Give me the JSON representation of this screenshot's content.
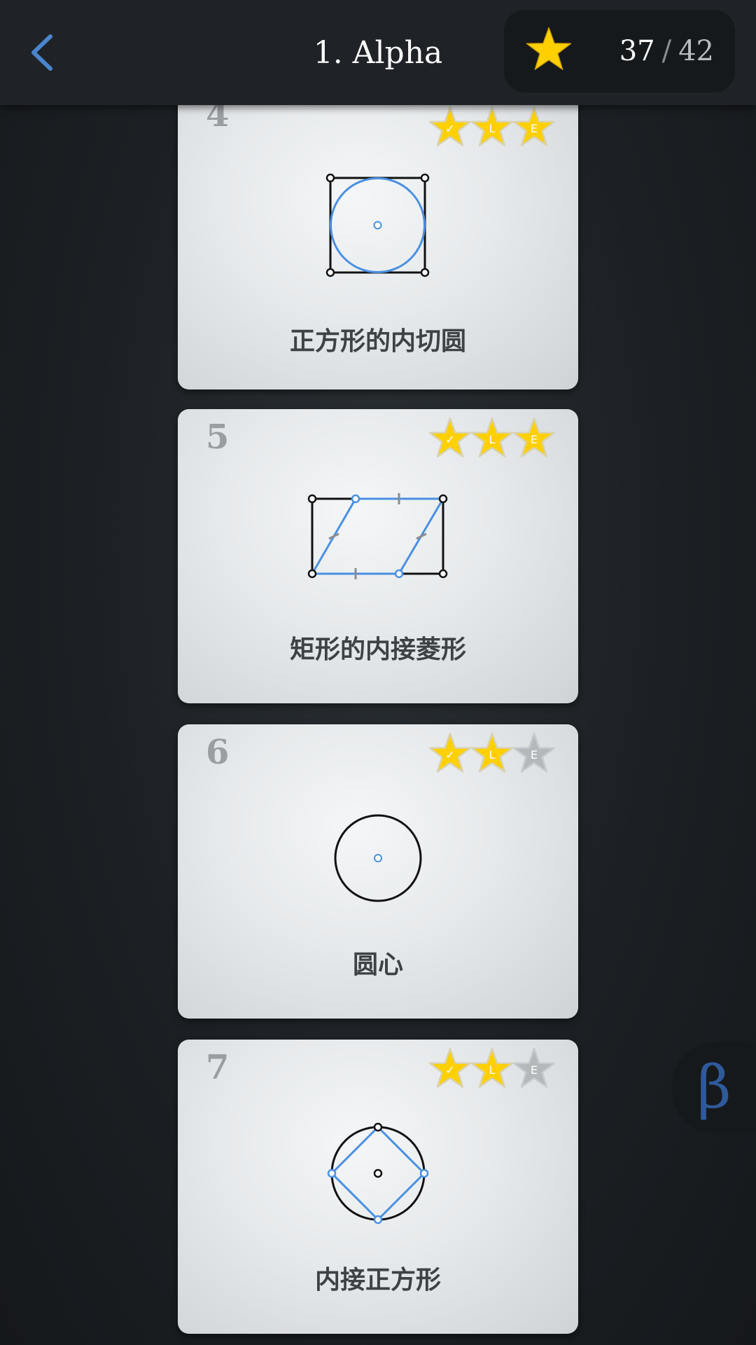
{
  "header": {
    "back_icon": "chevron-left-icon",
    "title": "1. Alpha",
    "score": {
      "icon": "star-icon",
      "earned": "37",
      "separator": "/",
      "total": "42"
    }
  },
  "colors": {
    "accent_blue": "#4a90e2",
    "star_gold": "#ffd000",
    "star_gray": "#b4b8bb",
    "card_text": "#3f4245",
    "beta_blue": "#2f5a9a"
  },
  "levels": [
    {
      "number": "4",
      "name": "正方形的内切圆",
      "stars": [
        {
          "letter": "✓",
          "earned": true
        },
        {
          "letter": "L",
          "earned": true
        },
        {
          "letter": "E",
          "earned": true
        }
      ]
    },
    {
      "number": "5",
      "name": "矩形的内接菱形",
      "stars": [
        {
          "letter": "✓",
          "earned": true
        },
        {
          "letter": "L",
          "earned": true
        },
        {
          "letter": "E",
          "earned": true
        }
      ]
    },
    {
      "number": "6",
      "name": "圆心",
      "stars": [
        {
          "letter": "✓",
          "earned": true
        },
        {
          "letter": "L",
          "earned": true
        },
        {
          "letter": "E",
          "earned": false
        }
      ]
    },
    {
      "number": "7",
      "name": "内接正方形",
      "stars": [
        {
          "letter": "✓",
          "earned": true
        },
        {
          "letter": "L",
          "earned": true
        },
        {
          "letter": "E",
          "earned": false
        }
      ]
    }
  ],
  "beta_button": {
    "glyph": "β"
  }
}
